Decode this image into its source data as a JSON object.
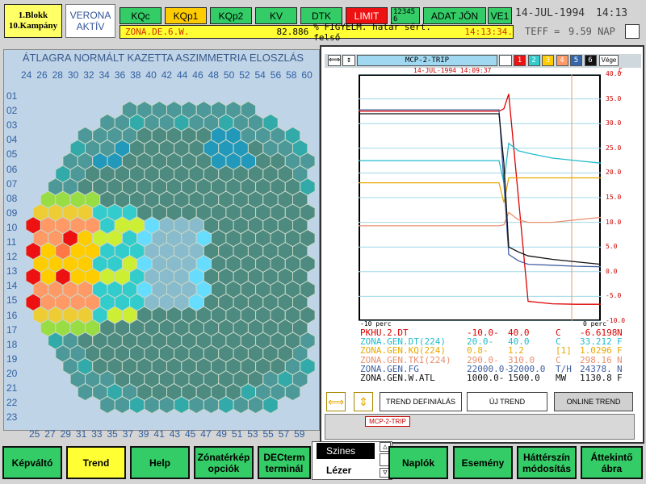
{
  "header": {
    "block_line1": "1.Blokk",
    "block_line2": "10.Kampány",
    "verona_line1": "VERONA",
    "verona_line2": "AKTÍV",
    "buttons": [
      "KQc",
      "KQp1",
      "KQp2",
      "KV",
      "DTK",
      "LIMIT"
    ],
    "grid_digits": "123456",
    "adat_jon": "ADAT JÖN",
    "ve1": "VE1",
    "date": "14-JUL-1994",
    "time": "14:13",
    "alarm_zone": "ZONA.DE.6.W.",
    "alarm_value": "82.886",
    "alarm_text": "% FIGYELM. határ sért. felső",
    "alarm_time": "14:13:34.",
    "teff_label": "TEFF =",
    "teff_value": "9.59 NAP"
  },
  "map": {
    "title": "ÁTLAGRA NORMÁLT KAZETTA ASZIMMETRIA ELOSZLÁS",
    "top_cols": [
      "24",
      "26",
      "28",
      "30",
      "32",
      "34",
      "36",
      "38",
      "40",
      "42",
      "44",
      "46",
      "48",
      "50",
      "52",
      "54",
      "56",
      "58",
      "60"
    ],
    "bottom_cols": [
      "25",
      "27",
      "29",
      "31",
      "33",
      "35",
      "37",
      "39",
      "41",
      "43",
      "45",
      "47",
      "49",
      "51",
      "53",
      "55",
      "57",
      "59"
    ],
    "rows": [
      "01",
      "02",
      "03",
      "04",
      "05",
      "06",
      "07",
      "08",
      "09",
      "10",
      "11",
      "12",
      "13",
      "14",
      "15",
      "16",
      "17",
      "18",
      "19",
      "20",
      "21",
      "22",
      "23"
    ]
  },
  "trend": {
    "title": "MCP-2-TRIP",
    "color_tabs": [
      "1",
      "2",
      "3",
      "4",
      "5",
      "6"
    ],
    "vege": "Vége",
    "timestamp": "14-JUL-1994 14:09:37",
    "unit_top": "C",
    "x_left": "-10 perc",
    "x_right": "0 perc",
    "legend": [
      {
        "name": "PKHU.2.DT",
        "lo": "-10.0-",
        "hi": "40.0",
        "unit": "C",
        "val": "-6.6198",
        "flag": "N",
        "color": "#dd0000"
      },
      {
        "name": "ZONA.GEN.DT(224)",
        "lo": "20.0-",
        "hi": "40.0",
        "unit": "C",
        "val": "33.212",
        "flag": "F",
        "color": "#22bbcc"
      },
      {
        "name": "ZONA.GEN.KQ(224)",
        "lo": "0.8-",
        "hi": "1.2",
        "unit": "[1]",
        "val": "1.0296",
        "flag": "F",
        "color": "#e8a800"
      },
      {
        "name": "ZONA.GEN.TKI(224)",
        "lo": "290.0-",
        "hi": "310.0",
        "unit": "C",
        "val": "298.16",
        "flag": "N",
        "color": "#e89070"
      },
      {
        "name": "ZONA.GEN.FG",
        "lo": "22000.0-",
        "hi": "32000.0",
        "unit": "T/H",
        "val": "24378.",
        "flag": "N",
        "color": "#4060a0"
      },
      {
        "name": "ZONA.GEN.W.ATL",
        "lo": "1000.0-",
        "hi": "1500.0",
        "unit": "MW",
        "val": "1130.8",
        "flag": "F",
        "color": "#111111"
      }
    ],
    "chart_data": {
      "type": "line",
      "xlim": [
        -10,
        0
      ],
      "ylim": [
        -10,
        40
      ],
      "right_ticks": [
        "40.0",
        "35.0",
        "30.0",
        "25.0",
        "20.0",
        "15.0",
        "10.0",
        "5.0",
        "0.0",
        "-5.0",
        "-10.0"
      ],
      "x": [
        -10,
        -4.2,
        -4.0,
        -3.8,
        -3.4,
        -3.0,
        -2.0,
        -1.0,
        0
      ],
      "series": [
        {
          "name": "PKHU.2.DT",
          "values": [
            32.5,
            32.5,
            33,
            36,
            15,
            -6,
            -6.5,
            -6.6,
            -6.6
          ]
        },
        {
          "name": "ZONA.GEN.DT(224)",
          "values": [
            22.5,
            22.5,
            18,
            26,
            24.5,
            24,
            23,
            22.5,
            22
          ]
        },
        {
          "name": "ZONA.GEN.KQ(224)",
          "values": [
            18,
            18,
            14,
            19,
            19,
            19,
            19,
            19,
            19
          ]
        },
        {
          "name": "ZONA.GEN.TKI(224)",
          "values": [
            9.3,
            9.3,
            9.5,
            12,
            10.5,
            10,
            10,
            10.5,
            11
          ]
        },
        {
          "name": "ZONA.GEN.FG",
          "values": [
            32.8,
            32.8,
            18,
            3.5,
            2.2,
            1.5,
            1.3,
            1.1,
            1.0
          ]
        },
        {
          "name": "ZONA.GEN.W.ATL",
          "values": [
            32,
            32,
            22,
            5,
            4,
            3.2,
            2.5,
            2.0,
            1.5
          ]
        }
      ]
    },
    "btn_define": "TREND DEFINIÁLÁS",
    "btn_new": "ÚJ TREND",
    "btn_online": "ONLINE TREND",
    "tag": "MCP-2-TRIP"
  },
  "footer": {
    "kepvalto": "Képváltó",
    "trend": "Trend",
    "help": "Help",
    "zonaterkep1": "Zónatérkép",
    "zonaterkep2": "opciók",
    "decterm1": "DECterm",
    "decterm2": "terminál",
    "popup_szines": "Szines",
    "popup_lezer": "Lézer",
    "naplok": "Naplók",
    "esemeny": "Esemény",
    "hatter1": "Háttérszín",
    "hatter2": "módosítás",
    "attekinto1": "Áttekintő",
    "attekinto2": "ábra"
  }
}
